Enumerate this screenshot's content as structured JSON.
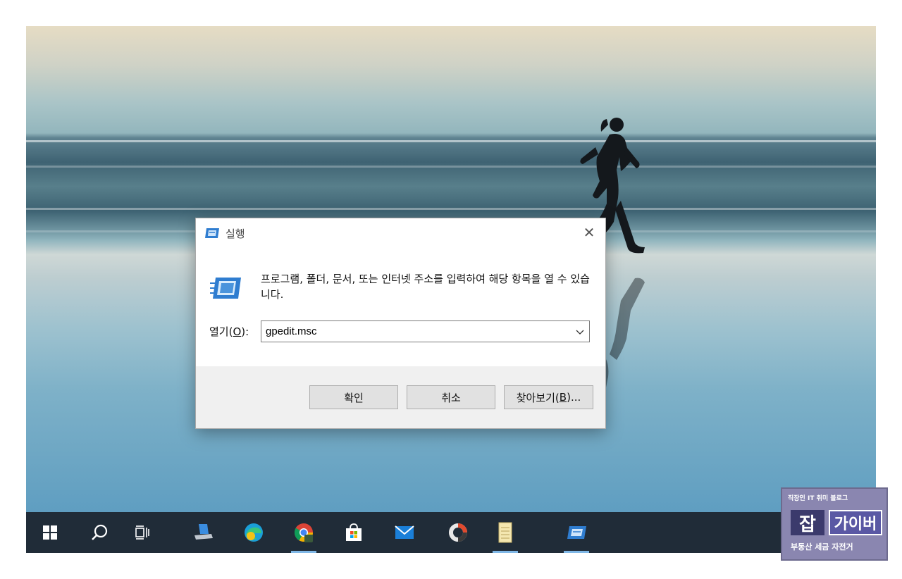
{
  "dialog": {
    "title": "실행",
    "description": "프로그램, 폴더, 문서, 또는 인터넷 주소를 입력하여 해당 항목을 열 수 있습니다.",
    "open_label_prefix": "열기(",
    "open_label_accel": "O",
    "open_label_suffix": "):",
    "command_value": "gpedit.msc",
    "ok_label": "확인",
    "cancel_label": "취소",
    "browse_label_prefix": "찾아보기(",
    "browse_label_accel": "B",
    "browse_label_suffix": ")...",
    "close_glyph": "✕"
  },
  "taskbar": {
    "items": [
      {
        "name": "start-button",
        "icon": "windows-logo-icon"
      },
      {
        "name": "search-button",
        "icon": "search-icon"
      },
      {
        "name": "task-view-button",
        "icon": "task-view-icon"
      },
      {
        "name": "network-app",
        "icon": "computer-network-icon"
      },
      {
        "name": "edge-browser",
        "icon": "edge-icon"
      },
      {
        "name": "chrome-browser",
        "icon": "chrome-icon",
        "active": true
      },
      {
        "name": "microsoft-store",
        "icon": "store-icon"
      },
      {
        "name": "mail-app",
        "icon": "mail-icon"
      },
      {
        "name": "donut-app",
        "icon": "ring-app-icon"
      },
      {
        "name": "notepad-app",
        "icon": "document-icon",
        "active": true
      },
      {
        "name": "run-app",
        "icon": "run-icon",
        "active": true
      }
    ]
  },
  "watermark": {
    "top_text": "직장인 IT 취미 블로그",
    "big_char": "잡",
    "big_text": "가이버",
    "bottom_text": "부동산 세금 자전거"
  },
  "colors": {
    "taskbar_bg": "#202c38",
    "dialog_footer_bg": "#f0f0f0",
    "button_bg": "#e1e1e1",
    "active_indicator": "#7fb7e6",
    "run_icon_blue": "#2f7dd0"
  }
}
